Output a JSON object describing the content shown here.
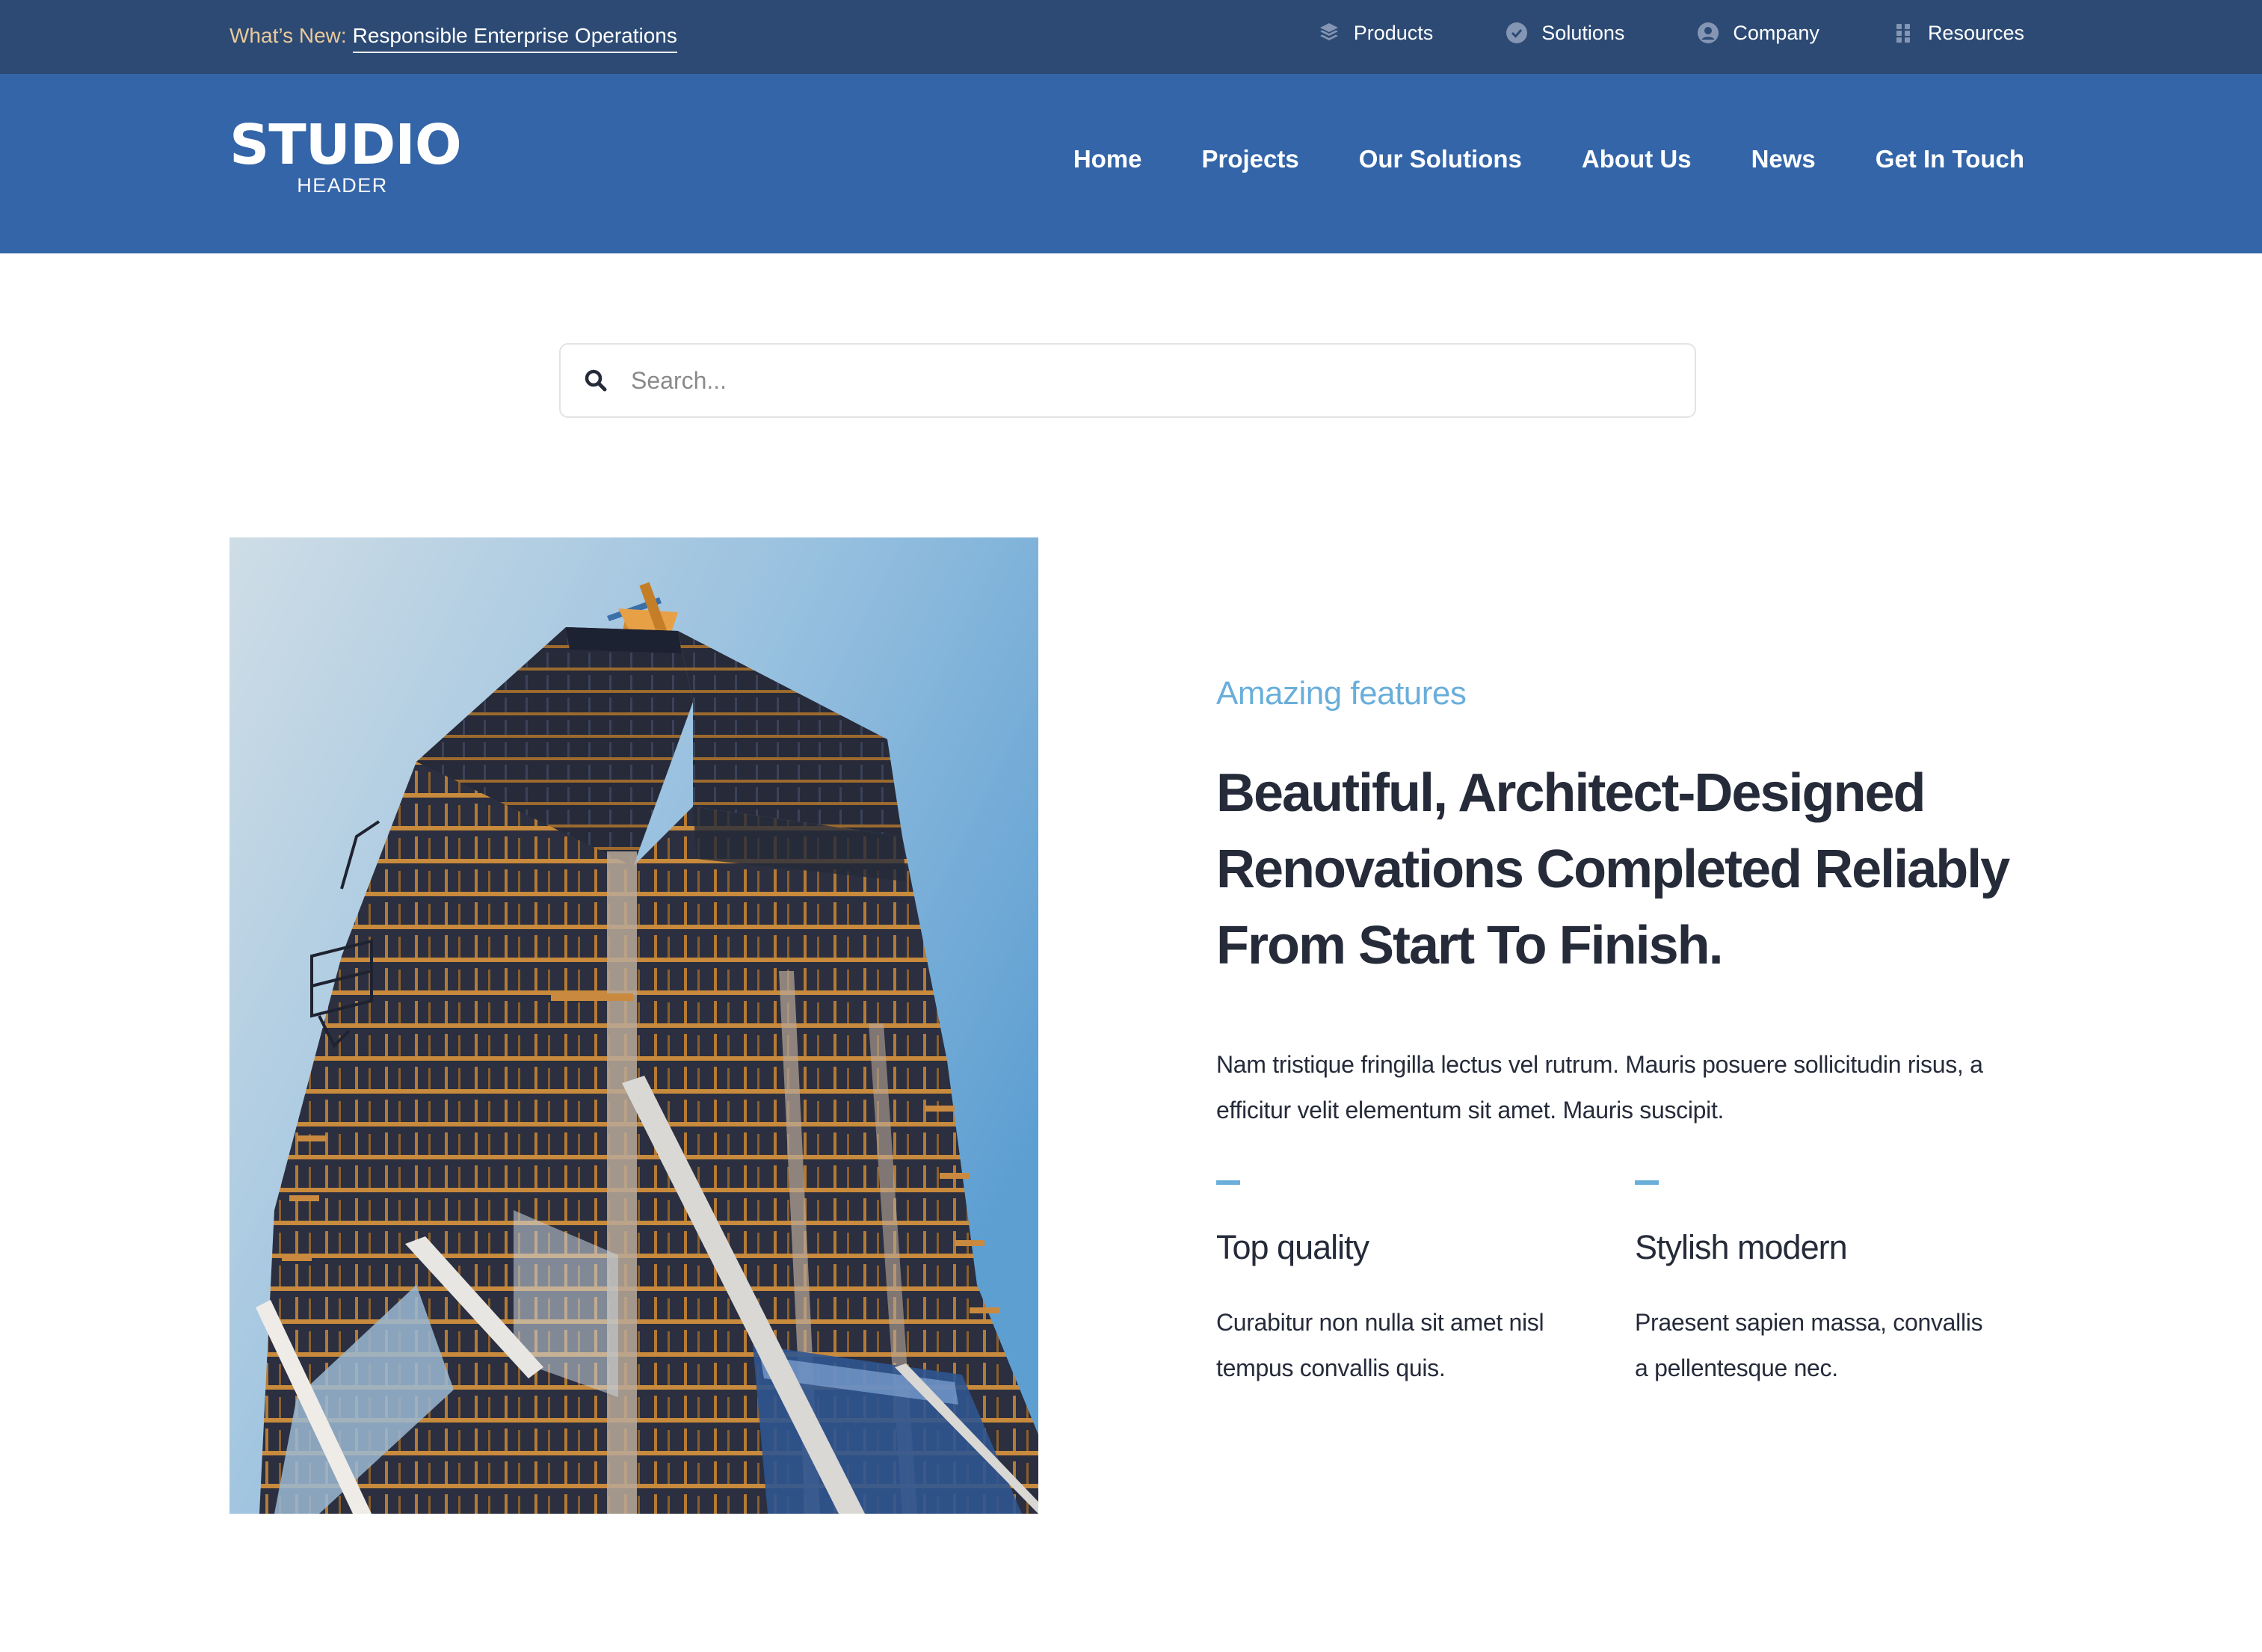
{
  "topbar": {
    "whats_new_label": "What’s New:",
    "whats_new_link": "Responsible Enterprise Operations",
    "items": [
      {
        "label": "Products",
        "icon": "layers-icon"
      },
      {
        "label": "Solutions",
        "icon": "check-circle-icon"
      },
      {
        "label": "Company",
        "icon": "user-circle-icon"
      },
      {
        "label": "Resources",
        "icon": "grid-dots-icon"
      }
    ]
  },
  "header": {
    "logo_main": "STUDIO",
    "logo_sub": "HEADER",
    "nav": [
      {
        "label": "Home"
      },
      {
        "label": "Projects"
      },
      {
        "label": "Our Solutions"
      },
      {
        "label": "About Us"
      },
      {
        "label": "News"
      },
      {
        "label": "Get In Touch"
      }
    ]
  },
  "search": {
    "placeholder": "Search...",
    "value": "",
    "icon": "search-icon"
  },
  "hero_image": {
    "alt": "Low-angle photo of a high-rise building under construction with a crane on top against a blue sky"
  },
  "content": {
    "eyebrow": "Amazing features",
    "headline": "Beautiful, Architect-Designed Renovations Completed Reliably From Start To Finish.",
    "lede": "Nam tristique fringilla lectus vel rutrum. Mauris posuere sollicitudin risus, a efficitur velit elementum sit amet. Mauris suscipit.",
    "features": [
      {
        "title": "Top quality",
        "text": "Curabitur non nulla sit amet nisl tempus convallis quis."
      },
      {
        "title": "Stylish modern",
        "text": "Praesent sapien massa, convallis a pellentesque nec."
      }
    ]
  },
  "colors": {
    "topbar_bg": "#2c4a74",
    "header_bg": "#3465a8",
    "whats_new_label": "#eac99a",
    "accent": "#6aaedb",
    "text_dark": "#262b3a"
  }
}
